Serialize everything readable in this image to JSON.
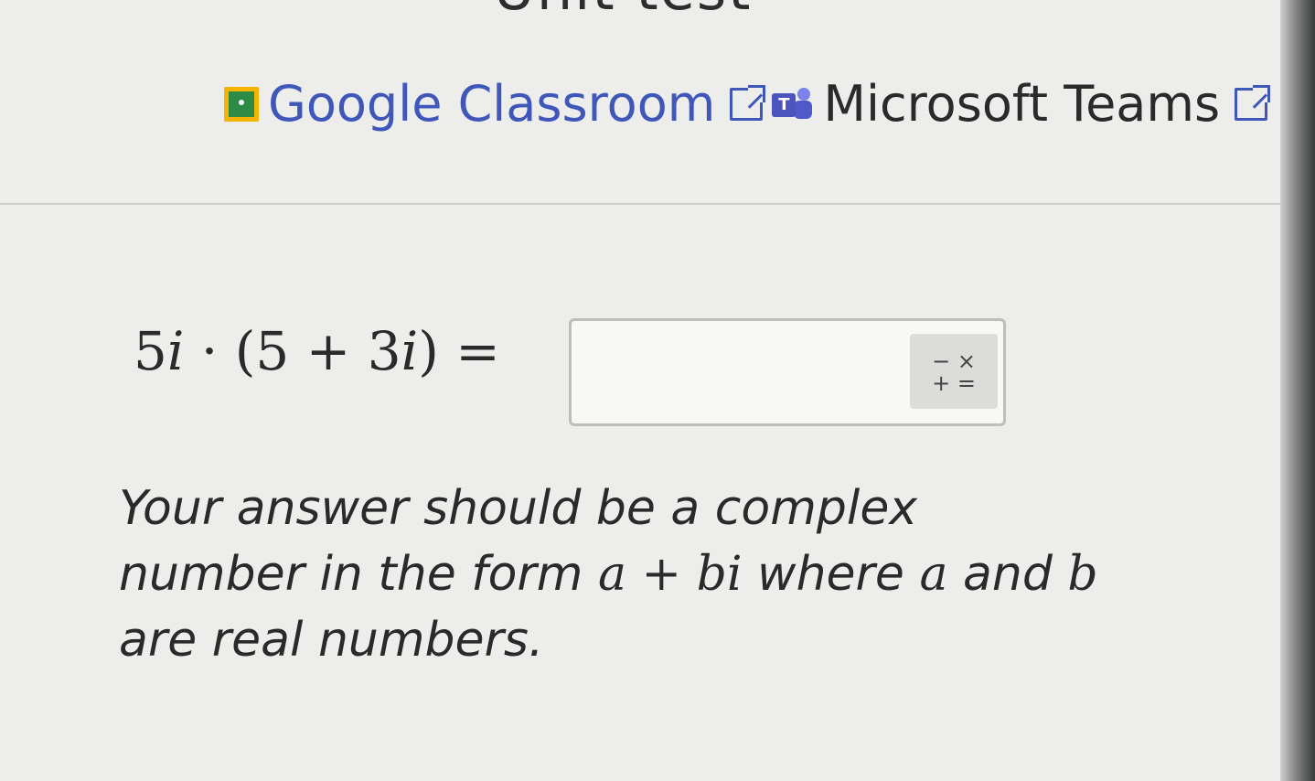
{
  "header": {
    "title": "Unit test"
  },
  "share": {
    "google_classroom": "Google Classroom",
    "microsoft_teams": "Microsoft Teams",
    "gc_icon": "google-classroom-icon",
    "teams_icon": "microsoft-teams-icon",
    "external_icon": "external-link-icon"
  },
  "problem": {
    "equation": "5𝑖 · (5 + 3𝑖) =",
    "answer_value": "",
    "math_keypad_symbols": [
      "−",
      "×",
      "+",
      "="
    ]
  },
  "instructions": {
    "part1": "Your answer should be a complex number in the form ",
    "expr": "a + bi",
    "part2": " where ",
    "var_a": "a",
    "part3": " and ",
    "var_b": "b",
    "part4": " are real numbers."
  },
  "colors": {
    "link": "#3e57b9",
    "background": "#ededeb",
    "google_classroom_yellow": "#f5b400",
    "google_classroom_green": "#2e8b45",
    "teams_purple": "#4b53bc"
  }
}
